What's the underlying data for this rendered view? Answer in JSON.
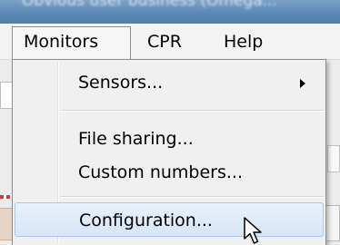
{
  "window": {
    "title": "Obvious user business (Omega..."
  },
  "menubar": {
    "items": [
      {
        "label": "Monitors"
      },
      {
        "label": "CPR"
      },
      {
        "label": "Help"
      }
    ]
  },
  "dropdown": {
    "items": [
      {
        "label": "Sensors...",
        "has_submenu": true
      },
      {
        "label": "File sharing..."
      },
      {
        "label": "Custom numbers..."
      },
      {
        "label": "Configuration...",
        "highlighted": true
      }
    ]
  },
  "colors": {
    "highlight_fill": "#d6e6f8",
    "highlight_border": "#a9c7ea",
    "menu_background": "#f0f0f0"
  },
  "icons": {
    "submenu_arrow": "submenu-arrow-icon",
    "cursor": "mouse-pointer-icon"
  }
}
